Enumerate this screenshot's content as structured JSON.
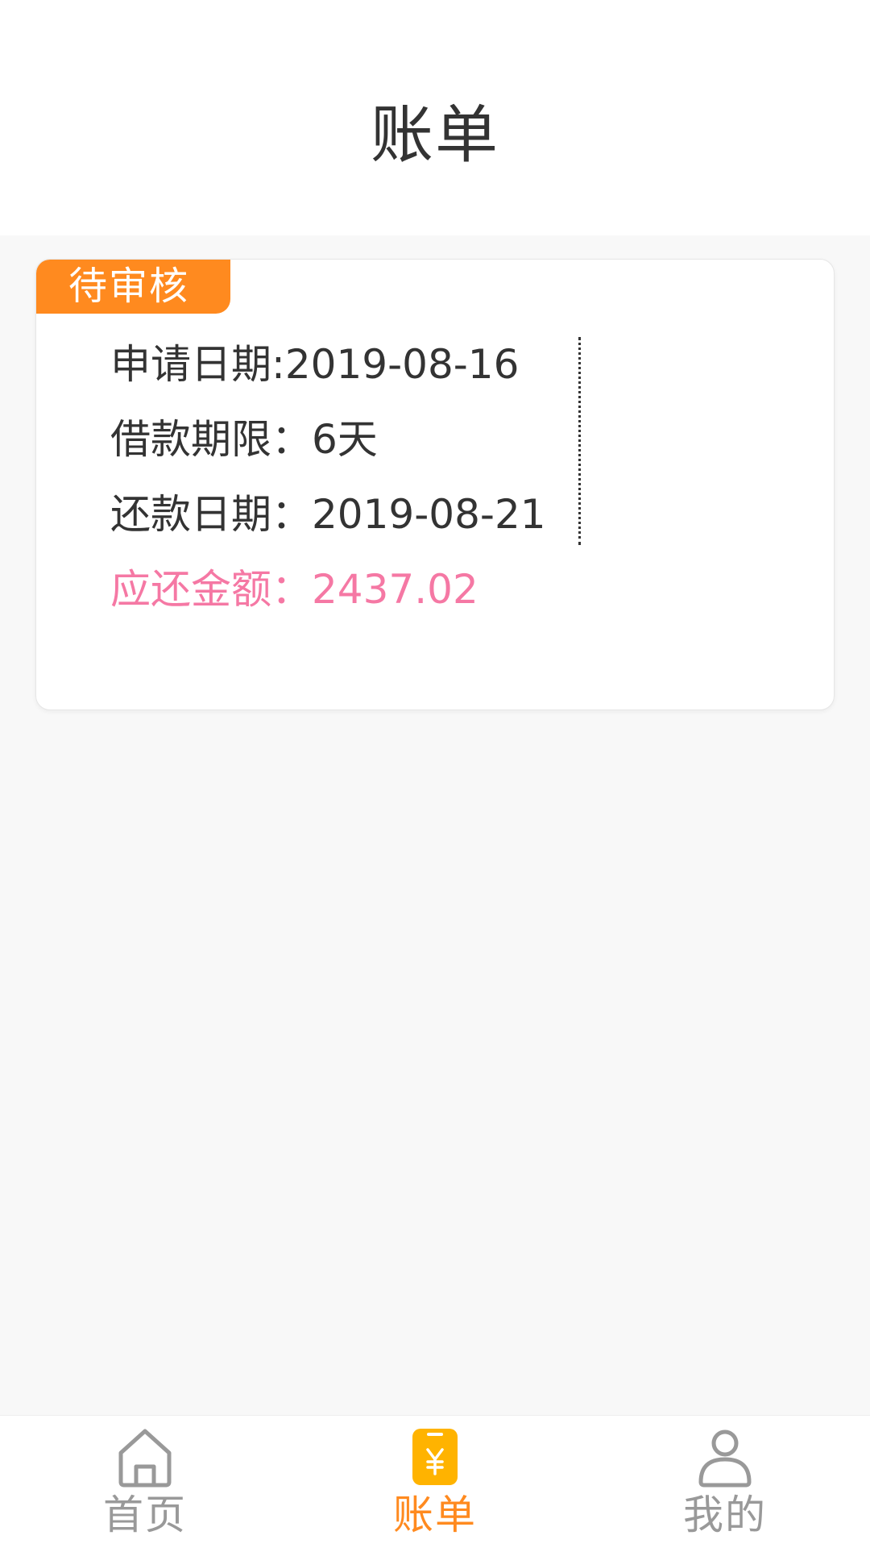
{
  "header": {
    "title": "账单"
  },
  "bill": {
    "status": "待审核",
    "apply_date": "申请日期:2019-08-16",
    "loan_term": "借款期限：6天",
    "repay_date": "还款日期：2019-08-21",
    "amount_due": "应还金额：2437.02"
  },
  "tabbar": {
    "items": [
      {
        "label": "首页",
        "icon": "home-icon",
        "active": false
      },
      {
        "label": "账单",
        "icon": "bill-icon",
        "active": true
      },
      {
        "label": "我的",
        "icon": "user-icon",
        "active": false
      }
    ]
  },
  "colors": {
    "accent": "#ff8a1f",
    "amount": "#f578a4",
    "inactive": "#999999",
    "active_icon": "#ffb300"
  }
}
